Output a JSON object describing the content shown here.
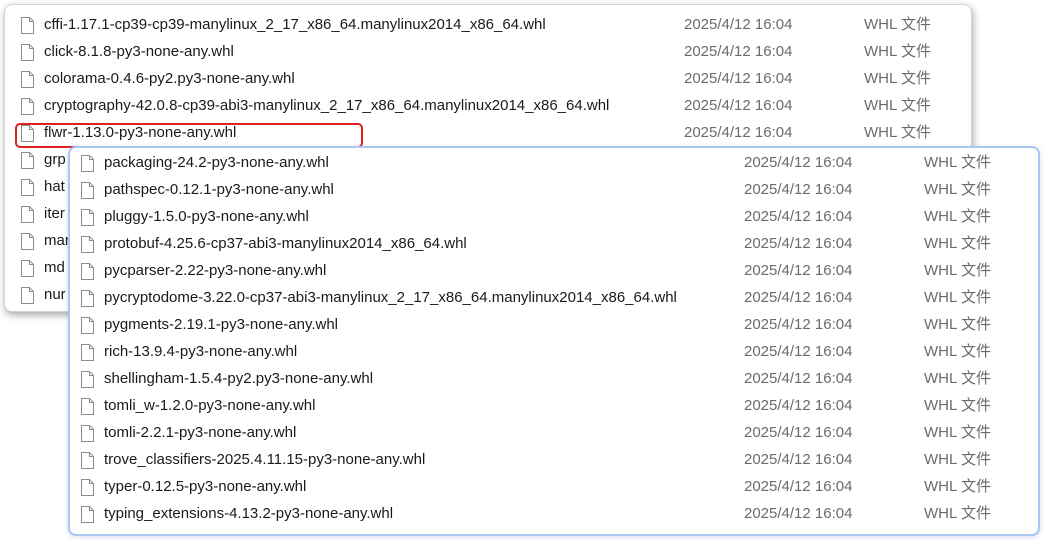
{
  "back_list": [
    {
      "name": "cffi-1.17.1-cp39-cp39-manylinux_2_17_x86_64.manylinux2014_x86_64.whl",
      "date": "2025/4/12 16:04",
      "type": "WHL 文件"
    },
    {
      "name": "click-8.1.8-py3-none-any.whl",
      "date": "2025/4/12 16:04",
      "type": "WHL 文件"
    },
    {
      "name": "colorama-0.4.6-py2.py3-none-any.whl",
      "date": "2025/4/12 16:04",
      "type": "WHL 文件"
    },
    {
      "name": "cryptography-42.0.8-cp39-abi3-manylinux_2_17_x86_64.manylinux2014_x86_64.whl",
      "date": "2025/4/12 16:04",
      "type": "WHL 文件"
    },
    {
      "name": "flwr-1.13.0-py3-none-any.whl",
      "date": "2025/4/12 16:04",
      "type": "WHL 文件"
    },
    {
      "name": "grp",
      "date": "",
      "type": ""
    },
    {
      "name": "hat",
      "date": "",
      "type": ""
    },
    {
      "name": "iter",
      "date": "",
      "type": ""
    },
    {
      "name": "mar",
      "date": "",
      "type": ""
    },
    {
      "name": "md",
      "date": "",
      "type": ""
    },
    {
      "name": "nur",
      "date": "",
      "type": ""
    }
  ],
  "front_list": [
    {
      "name": "packaging-24.2-py3-none-any.whl",
      "date": "2025/4/12 16:04",
      "type": "WHL 文件"
    },
    {
      "name": "pathspec-0.12.1-py3-none-any.whl",
      "date": "2025/4/12 16:04",
      "type": "WHL 文件"
    },
    {
      "name": "pluggy-1.5.0-py3-none-any.whl",
      "date": "2025/4/12 16:04",
      "type": "WHL 文件"
    },
    {
      "name": "protobuf-4.25.6-cp37-abi3-manylinux2014_x86_64.whl",
      "date": "2025/4/12 16:04",
      "type": "WHL 文件"
    },
    {
      "name": "pycparser-2.22-py3-none-any.whl",
      "date": "2025/4/12 16:04",
      "type": "WHL 文件"
    },
    {
      "name": "pycryptodome-3.22.0-cp37-abi3-manylinux_2_17_x86_64.manylinux2014_x86_64.whl",
      "date": "2025/4/12 16:04",
      "type": "WHL 文件"
    },
    {
      "name": "pygments-2.19.1-py3-none-any.whl",
      "date": "2025/4/12 16:04",
      "type": "WHL 文件"
    },
    {
      "name": "rich-13.9.4-py3-none-any.whl",
      "date": "2025/4/12 16:04",
      "type": "WHL 文件"
    },
    {
      "name": "shellingham-1.5.4-py2.py3-none-any.whl",
      "date": "2025/4/12 16:04",
      "type": "WHL 文件"
    },
    {
      "name": "tomli_w-1.2.0-py3-none-any.whl",
      "date": "2025/4/12 16:04",
      "type": "WHL 文件"
    },
    {
      "name": "tomli-2.2.1-py3-none-any.whl",
      "date": "2025/4/12 16:04",
      "type": "WHL 文件"
    },
    {
      "name": "trove_classifiers-2025.4.11.15-py3-none-any.whl",
      "date": "2025/4/12 16:04",
      "type": "WHL 文件"
    },
    {
      "name": "typer-0.12.5-py3-none-any.whl",
      "date": "2025/4/12 16:04",
      "type": "WHL 文件"
    },
    {
      "name": "typing_extensions-4.13.2-py3-none-any.whl",
      "date": "2025/4/12 16:04",
      "type": "WHL 文件"
    }
  ],
  "colors": {
    "highlight_border": "#e02020",
    "front_panel_border": "#a9c7f0",
    "secondary_text": "#6b6b6b"
  },
  "icons": {
    "file": "file-icon"
  }
}
